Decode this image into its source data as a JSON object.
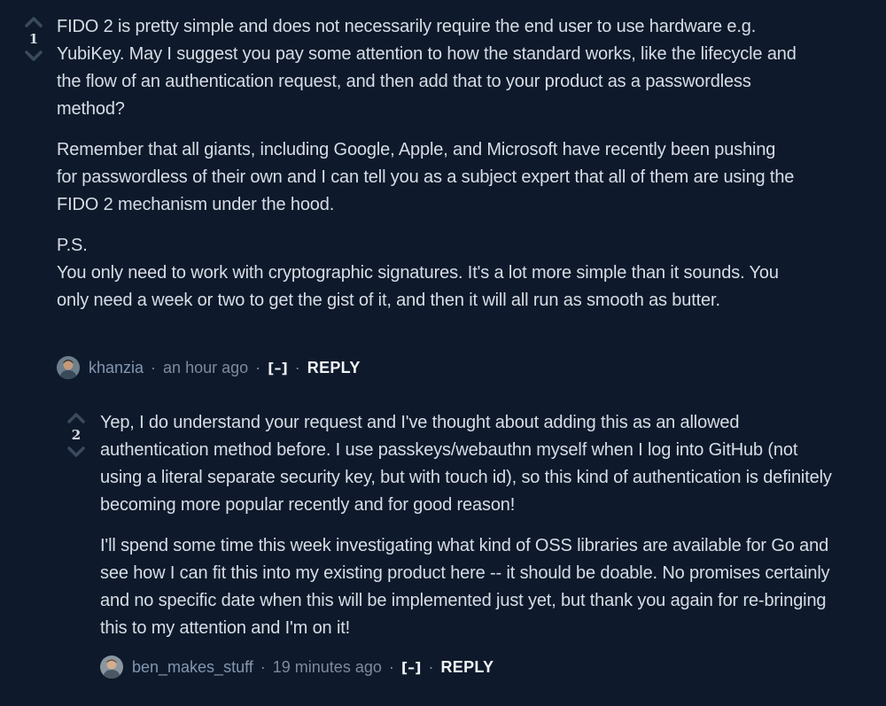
{
  "comments": [
    {
      "votes": "1",
      "paragraphs": [
        "FIDO 2 is pretty simple and does not necessarily require the end user to use hardware e.g. YubiKey. May I suggest you pay some attention to how the standard works, like the lifecycle and the flow of an authentication request, and then add that to your product as a passwordless method?",
        "Remember that all giants, including Google, Apple, and Microsoft have recently been pushing for passwordless of their own and I can tell you as a subject expert that all of them are using the FIDO 2 mechanism under the hood.",
        "P.S.\nYou only need to work with cryptographic signatures. It's a lot more simple than it sounds. You only need a week or two to get the gist of it, and then it will all run as smooth as butter."
      ],
      "author": "khanzia",
      "time": "an hour ago",
      "collapse": "[–]",
      "reply": "REPLY",
      "separator": "·"
    },
    {
      "votes": "2",
      "paragraphs": [
        "Yep, I do understand your request and I've thought about adding this as an allowed authentication method before. I use passkeys/webauthn myself when I log into GitHub (not using a literal separate security key, but with touch id), so this kind of authentication is definitely becoming more popular recently and for good reason!",
        "I'll spend some time this week investigating what kind of OSS libraries are available for Go and see how I can fit this into my existing product here -- it should be doable. No promises certainly and no specific date when this will be implemented just yet, but thank you again for re-bringing this to my attention and I'm on it!"
      ],
      "author": "ben_makes_stuff",
      "time": "19 minutes ago",
      "collapse": "[–]",
      "reply": "REPLY",
      "separator": "·"
    }
  ],
  "icons": {
    "upvote": "chevron-up-icon",
    "downvote": "chevron-down-icon"
  },
  "colors": {
    "background": "#0e1a2b",
    "text": "#d7dde6",
    "meta": "#7e8b9c",
    "author": "#8496b0",
    "vote_arrow": "#3a4a5e"
  }
}
